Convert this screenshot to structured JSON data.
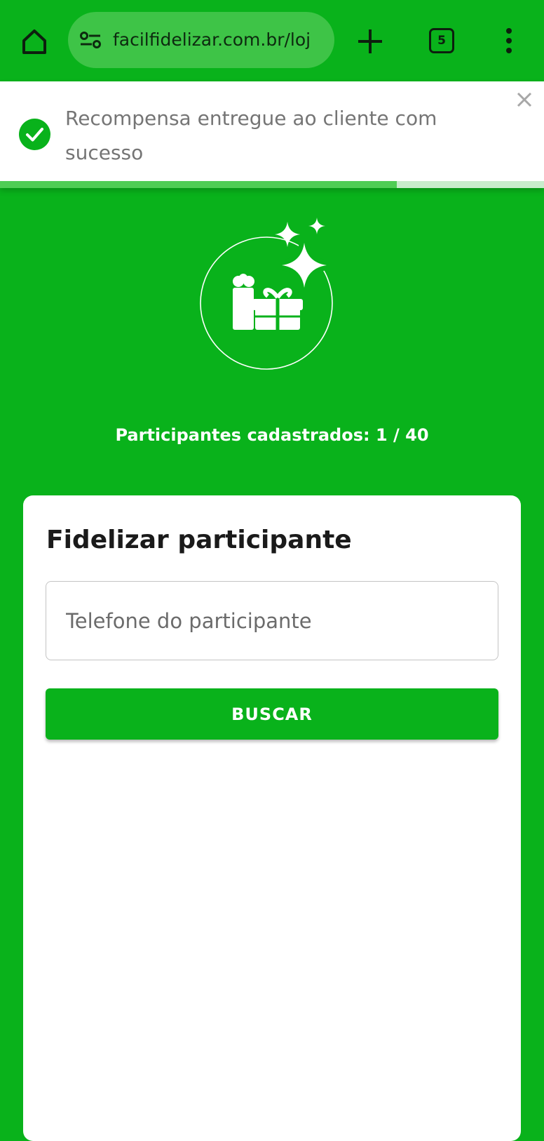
{
  "browser": {
    "url": "facilfidelizar.com.br/loj",
    "tab_count": "5",
    "icons": [
      "home-icon",
      "site-settings-icon",
      "plus-icon",
      "tabs-icon",
      "more-vert-icon"
    ]
  },
  "toast": {
    "message": "Recompensa entregue ao cliente com sucesso",
    "icon": "check-circle-icon",
    "close_icon": "close-icon",
    "progress": 0.73,
    "colors": {
      "progress_fill": "#4fcd55",
      "progress_track": "#c7eccb",
      "check": "#09b21b"
    }
  },
  "hero": {
    "icon": "gift-sparkles-icon"
  },
  "participants": {
    "label": "Participantes cadastrados:",
    "count": "1 / 40"
  },
  "card": {
    "title": "Fidelizar participante",
    "phone_placeholder": "Telefone do participante",
    "phone_value": "",
    "search_label": "BUSCAR"
  },
  "colors": {
    "brand_green": "#09b21b",
    "url_pill": "#3ec447",
    "card_bg": "#ffffff"
  }
}
